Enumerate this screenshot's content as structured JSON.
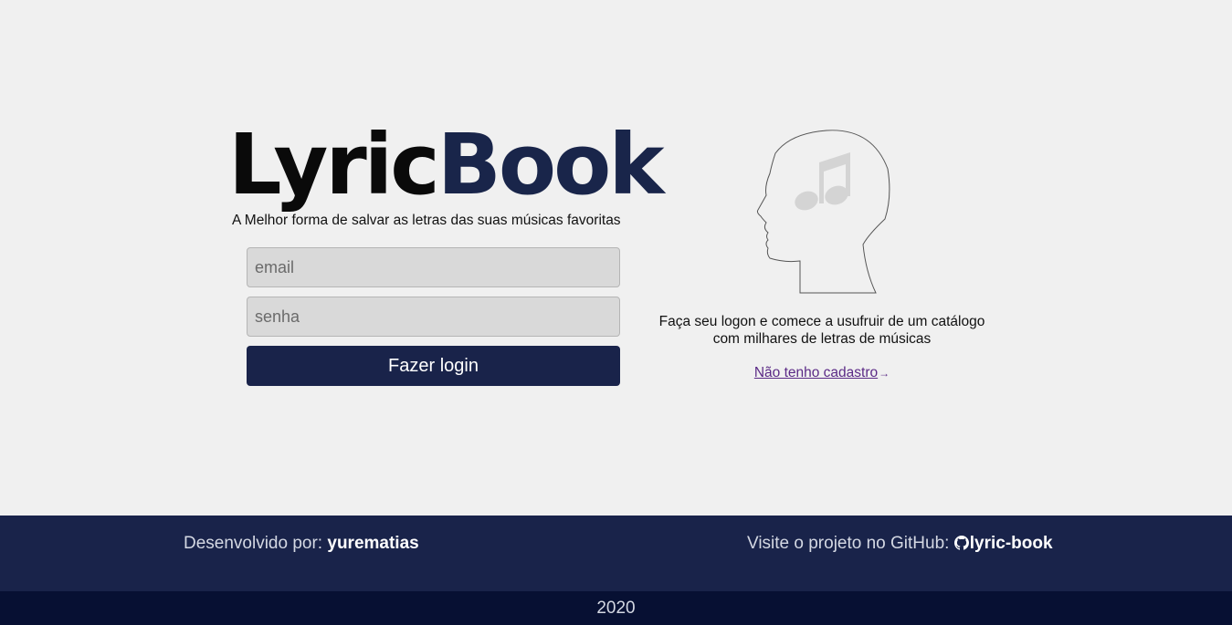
{
  "logo": {
    "part1": "Lyric",
    "part2": "Book"
  },
  "tagline": "A Melhor forma de salvar as letras das suas músicas favoritas",
  "form": {
    "email_placeholder": "email",
    "password_placeholder": "senha",
    "login_label": "Fazer login"
  },
  "side": {
    "description_line1": "Faça seu logon e comece a usufruir de um catálogo",
    "description_line2": "com milhares de letras de músicas",
    "signup_link": "Não tenho cadastro",
    "illustration_icon": "head-music-note-icon"
  },
  "footer": {
    "developed_by_label": "Desenvolvido por:",
    "developer": "yurematias",
    "github_label": "Visite o projeto no GitHub:",
    "github_icon": "github-icon",
    "repo": "lyric-book",
    "year": "2020"
  },
  "colors": {
    "background": "#f0f0f0",
    "brand_dark": "#19234a",
    "footer_bottom": "#071033",
    "link": "#5b2a86"
  }
}
